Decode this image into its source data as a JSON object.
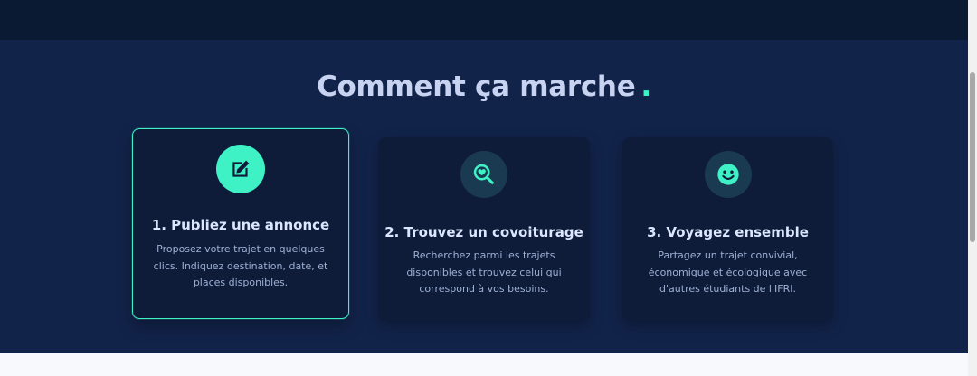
{
  "section": {
    "title": "Comment ça marche",
    "title_dot": "."
  },
  "cards": [
    {
      "title": "1. Publiez une annonce",
      "description": "Proposez votre trajet en quelques clics. Indiquez destination, date, et places disponibles.",
      "icon": "edit-icon",
      "active": true
    },
    {
      "title": "2. Trouvez un covoiturage",
      "description": "Recherchez parmi les trajets disponibles et trouvez celui qui correspond à vos besoins.",
      "icon": "search-heart-icon",
      "active": false
    },
    {
      "title": "3. Voyagez ensemble",
      "description": "Partagez un trajet convivial, économique et écologique avec d'autres étudiants de l'IFRI.",
      "icon": "smile-icon",
      "active": false
    }
  ],
  "colors": {
    "accent": "#3ef2c6",
    "section_bg": "#12234a",
    "card_bg": "#0e1c3a",
    "title": "#c7d3f1"
  }
}
